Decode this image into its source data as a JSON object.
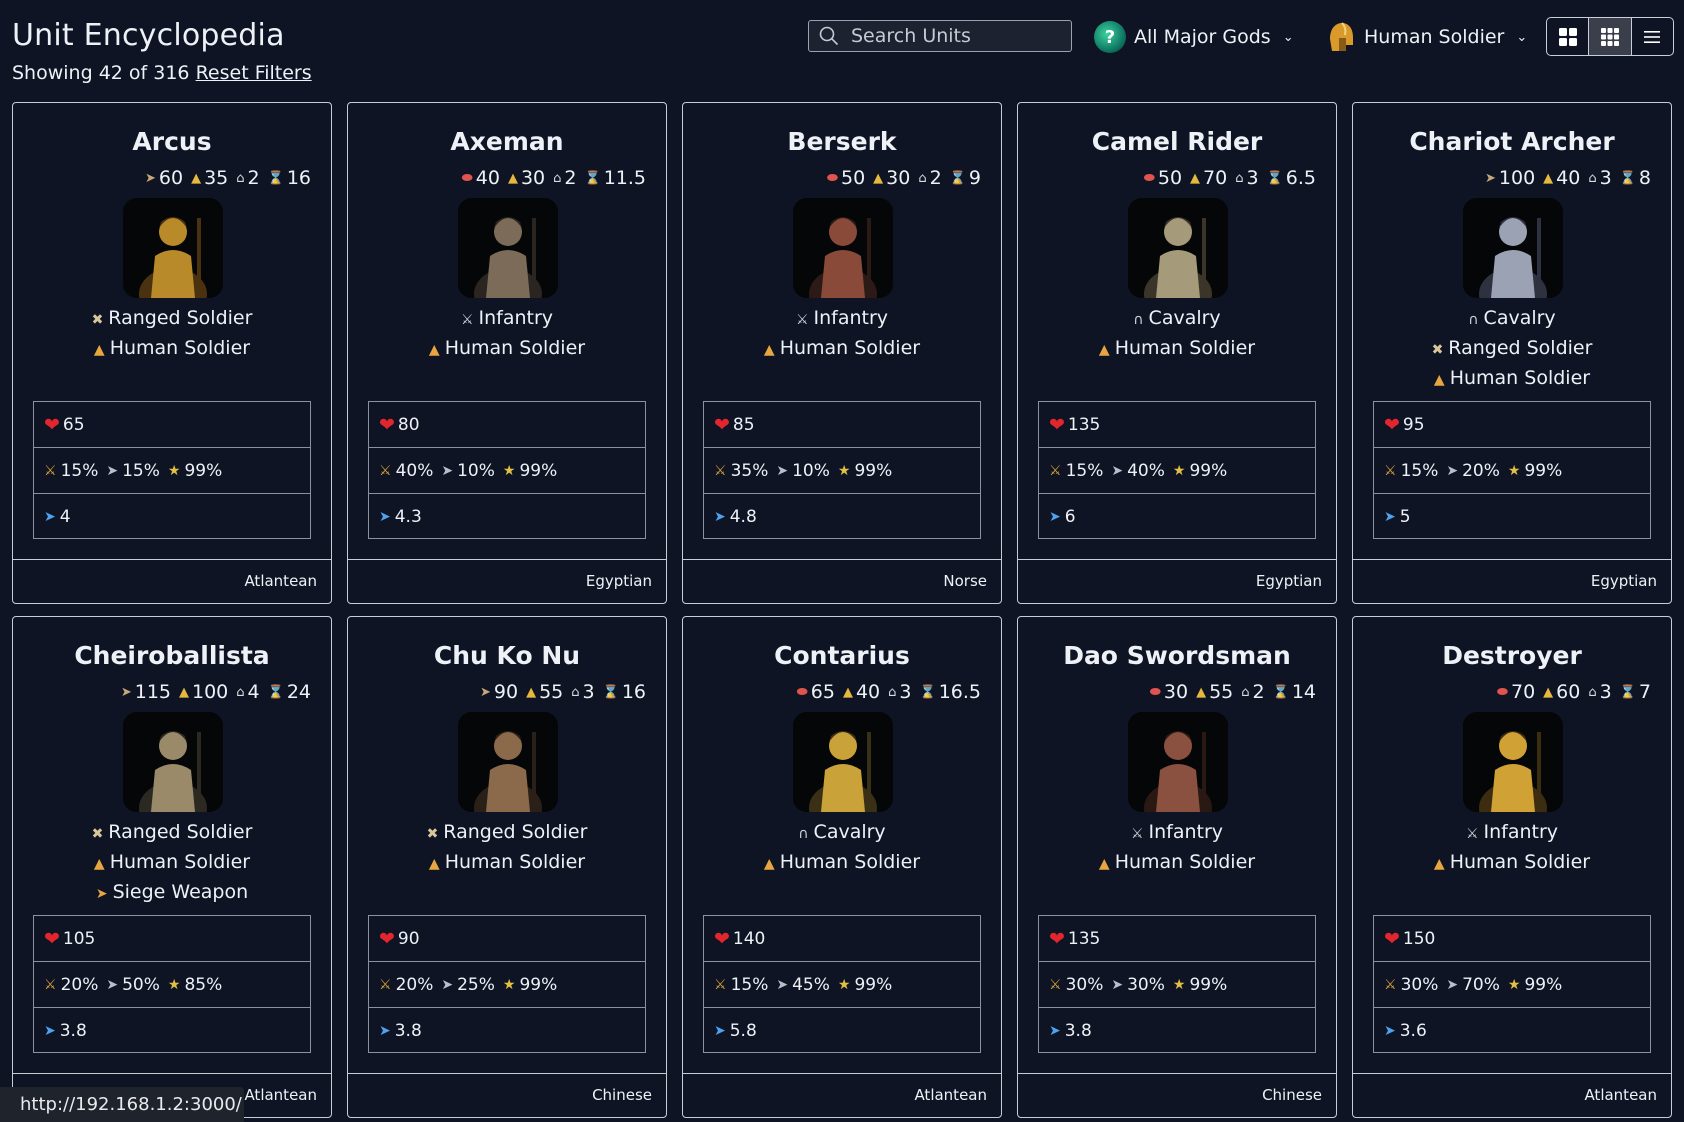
{
  "header": {
    "title": "Unit Encyclopedia",
    "showing": "Showing 42 of 316",
    "reset_label": "Reset Filters",
    "search_placeholder": "Search Units",
    "gods_filter": "All Major Gods",
    "type_filter": "Human Soldier",
    "view_modes": [
      "large-grid",
      "small-grid",
      "list"
    ],
    "active_view": "small-grid"
  },
  "units": [
    {
      "name": "Arcus",
      "cost": [
        {
          "res": "wood",
          "value": "60"
        },
        {
          "res": "gold",
          "value": "35"
        },
        {
          "res": "pop",
          "value": "2"
        },
        {
          "res": "time",
          "value": "16"
        }
      ],
      "tags": [
        {
          "icon": "ranged",
          "label": "Ranged Soldier"
        },
        {
          "icon": "human",
          "label": "Human Soldier"
        }
      ],
      "hp": "65",
      "armor": {
        "hack": "15%",
        "pierce": "15%",
        "crush": "99%"
      },
      "speed": "4",
      "culture": "Atlantean"
    },
    {
      "name": "Axeman",
      "cost": [
        {
          "res": "food",
          "value": "40"
        },
        {
          "res": "gold",
          "value": "30"
        },
        {
          "res": "pop",
          "value": "2"
        },
        {
          "res": "time",
          "value": "11.5"
        }
      ],
      "tags": [
        {
          "icon": "infantry",
          "label": "Infantry"
        },
        {
          "icon": "human",
          "label": "Human Soldier"
        }
      ],
      "hp": "80",
      "armor": {
        "hack": "40%",
        "pierce": "10%",
        "crush": "99%"
      },
      "speed": "4.3",
      "culture": "Egyptian"
    },
    {
      "name": "Berserk",
      "cost": [
        {
          "res": "food",
          "value": "50"
        },
        {
          "res": "gold",
          "value": "30"
        },
        {
          "res": "pop",
          "value": "2"
        },
        {
          "res": "time",
          "value": "9"
        }
      ],
      "tags": [
        {
          "icon": "infantry",
          "label": "Infantry"
        },
        {
          "icon": "human",
          "label": "Human Soldier"
        }
      ],
      "hp": "85",
      "armor": {
        "hack": "35%",
        "pierce": "10%",
        "crush": "99%"
      },
      "speed": "4.8",
      "culture": "Norse"
    },
    {
      "name": "Camel Rider",
      "cost": [
        {
          "res": "food",
          "value": "50"
        },
        {
          "res": "gold",
          "value": "70"
        },
        {
          "res": "pop",
          "value": "3"
        },
        {
          "res": "time",
          "value": "6.5"
        }
      ],
      "tags": [
        {
          "icon": "cav",
          "label": "Cavalry"
        },
        {
          "icon": "human",
          "label": "Human Soldier"
        }
      ],
      "hp": "135",
      "armor": {
        "hack": "15%",
        "pierce": "40%",
        "crush": "99%"
      },
      "speed": "6",
      "culture": "Egyptian"
    },
    {
      "name": "Chariot Archer",
      "cost": [
        {
          "res": "wood",
          "value": "100"
        },
        {
          "res": "gold",
          "value": "40"
        },
        {
          "res": "pop",
          "value": "3"
        },
        {
          "res": "time",
          "value": "8"
        }
      ],
      "tags": [
        {
          "icon": "cav",
          "label": "Cavalry"
        },
        {
          "icon": "ranged",
          "label": "Ranged Soldier"
        },
        {
          "icon": "human",
          "label": "Human Soldier"
        }
      ],
      "hp": "95",
      "armor": {
        "hack": "15%",
        "pierce": "20%",
        "crush": "99%"
      },
      "speed": "5",
      "culture": "Egyptian"
    },
    {
      "name": "Cheiroballista",
      "cost": [
        {
          "res": "wood",
          "value": "115"
        },
        {
          "res": "gold",
          "value": "100"
        },
        {
          "res": "pop",
          "value": "4"
        },
        {
          "res": "time",
          "value": "24"
        }
      ],
      "tags": [
        {
          "icon": "ranged",
          "label": "Ranged Soldier"
        },
        {
          "icon": "human",
          "label": "Human Soldier"
        },
        {
          "icon": "siege",
          "label": "Siege Weapon"
        }
      ],
      "hp": "105",
      "armor": {
        "hack": "20%",
        "pierce": "50%",
        "crush": "85%"
      },
      "speed": "3.8",
      "culture": "Atlantean"
    },
    {
      "name": "Chu Ko Nu",
      "cost": [
        {
          "res": "wood",
          "value": "90"
        },
        {
          "res": "gold",
          "value": "55"
        },
        {
          "res": "pop",
          "value": "3"
        },
        {
          "res": "time",
          "value": "16"
        }
      ],
      "tags": [
        {
          "icon": "ranged",
          "label": "Ranged Soldier"
        },
        {
          "icon": "human",
          "label": "Human Soldier"
        }
      ],
      "hp": "90",
      "armor": {
        "hack": "20%",
        "pierce": "25%",
        "crush": "99%"
      },
      "speed": "3.8",
      "culture": "Chinese"
    },
    {
      "name": "Contarius",
      "cost": [
        {
          "res": "food",
          "value": "65"
        },
        {
          "res": "gold",
          "value": "40"
        },
        {
          "res": "pop",
          "value": "3"
        },
        {
          "res": "time",
          "value": "16.5"
        }
      ],
      "tags": [
        {
          "icon": "cav",
          "label": "Cavalry"
        },
        {
          "icon": "human",
          "label": "Human Soldier"
        }
      ],
      "hp": "140",
      "armor": {
        "hack": "15%",
        "pierce": "45%",
        "crush": "99%"
      },
      "speed": "5.8",
      "culture": "Atlantean"
    },
    {
      "name": "Dao Swordsman",
      "cost": [
        {
          "res": "food",
          "value": "30"
        },
        {
          "res": "gold",
          "value": "55"
        },
        {
          "res": "pop",
          "value": "2"
        },
        {
          "res": "time",
          "value": "14"
        }
      ],
      "tags": [
        {
          "icon": "infantry",
          "label": "Infantry"
        },
        {
          "icon": "human",
          "label": "Human Soldier"
        }
      ],
      "hp": "135",
      "armor": {
        "hack": "30%",
        "pierce": "30%",
        "crush": "99%"
      },
      "speed": "3.8",
      "culture": "Chinese"
    },
    {
      "name": "Destroyer",
      "cost": [
        {
          "res": "food",
          "value": "70"
        },
        {
          "res": "gold",
          "value": "60"
        },
        {
          "res": "pop",
          "value": "3"
        },
        {
          "res": "time",
          "value": "7"
        }
      ],
      "tags": [
        {
          "icon": "infantry",
          "label": "Infantry"
        },
        {
          "icon": "human",
          "label": "Human Soldier"
        }
      ],
      "hp": "150",
      "armor": {
        "hack": "30%",
        "pierce": "70%",
        "crush": "99%"
      },
      "speed": "3.6",
      "culture": "Atlantean"
    }
  ],
  "status_url": "http://192.168.1.2:3000/"
}
